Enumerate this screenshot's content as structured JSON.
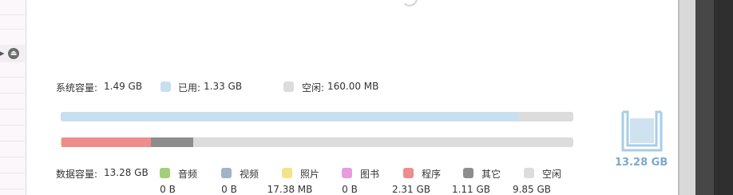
{
  "system": {
    "capacity_label": "系统容量:",
    "capacity_value": "1.49 GB",
    "used_label": "已用:",
    "used_value": "1.33 GB",
    "free_label": "空闲:",
    "free_value": "160.00 MB",
    "used_fraction": 0.892,
    "used_color": "#c8dff0",
    "free_color": "#dcdcdc"
  },
  "data_storage": {
    "capacity_label": "数据容量:",
    "capacity_value": "13.28 GB",
    "total_display": "13.28 GB",
    "categories": [
      {
        "label": "音频",
        "value": "0 B",
        "color": "#a3cf78",
        "fraction": 0
      },
      {
        "label": "视频",
        "value": "0 B",
        "color": "#a1b3c6",
        "fraction": 0
      },
      {
        "label": "照片",
        "value": "17.38 MB",
        "color": "#f4e38a",
        "fraction": 0.0013
      },
      {
        "label": "图书",
        "value": "0 B",
        "color": "#e89ce0",
        "fraction": 0
      },
      {
        "label": "程序",
        "value": "2.31 GB",
        "color": "#ef8c8c",
        "fraction": 0.174
      },
      {
        "label": "其它",
        "value": "1.11 GB",
        "color": "#8d8d8d",
        "fraction": 0.084
      },
      {
        "label": "空闲",
        "value": "9.85 GB",
        "color": "#dcdcdc",
        "fraction": 0.742
      }
    ]
  }
}
